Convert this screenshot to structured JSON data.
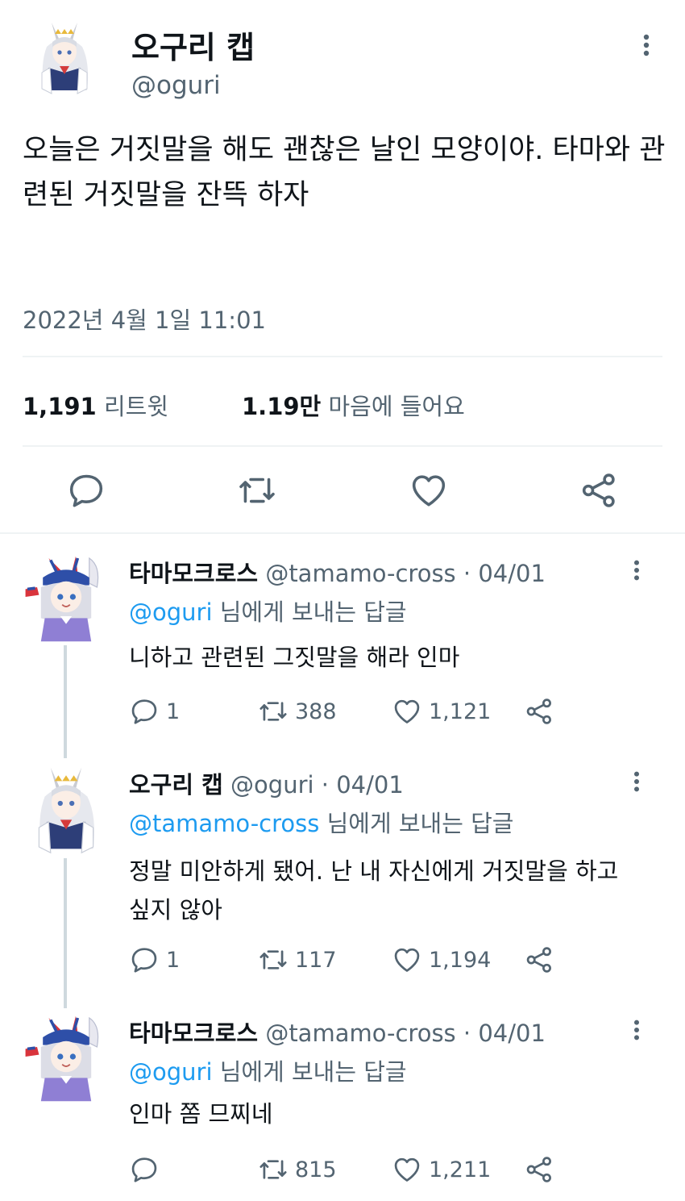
{
  "tweet": {
    "author_name": "오구리 캡",
    "author_handle": "@oguri",
    "text": "오늘은 거짓말을 해도 괜찮은 날인 모양이야. 타마와 관련된 거짓말을 잔뜩 하자",
    "timestamp": "2022년 4월 1일 11:01",
    "retweets_count": "1,191",
    "retweets_label": "리트윗",
    "likes_count": "1.19만",
    "likes_label": "마음에 들어요"
  },
  "replies": [
    {
      "name": "타마모크로스",
      "handle": "@tamamo-cross",
      "date": "· 04/01",
      "mention": "@oguri",
      "reply_to_suffix": " 님에게 보내는 답글",
      "text": "니하고 관련된 그짓말을 해라 인마",
      "replies": "1",
      "retweets": "388",
      "likes": "1,121"
    },
    {
      "name": "오구리 캡",
      "handle": "@oguri",
      "date": "· 04/01",
      "mention": "@tamamo-cross",
      "reply_to_suffix": " 님에게 보내는 답글",
      "text": "정말 미안하게 됐어. 난 내 자신에게 거짓말을 하고 싶지 않아",
      "replies": "1",
      "retweets": "117",
      "likes": "1,194"
    },
    {
      "name": "타마모크로스",
      "handle": "@tamamo-cross",
      "date": "· 04/01",
      "mention": "@oguri",
      "reply_to_suffix": " 님에게 보내는 답글",
      "text": "인마 쫌 므찌네",
      "replies": "",
      "retweets": "815",
      "likes": "1,211"
    }
  ],
  "colors": {
    "text_primary": "#0f1419",
    "text_secondary": "#536471",
    "link": "#1d9bf0",
    "divider": "#eff3f4"
  },
  "icons": [
    "more-vertical-icon",
    "reply-icon",
    "retweet-icon",
    "like-icon",
    "share-icon"
  ]
}
